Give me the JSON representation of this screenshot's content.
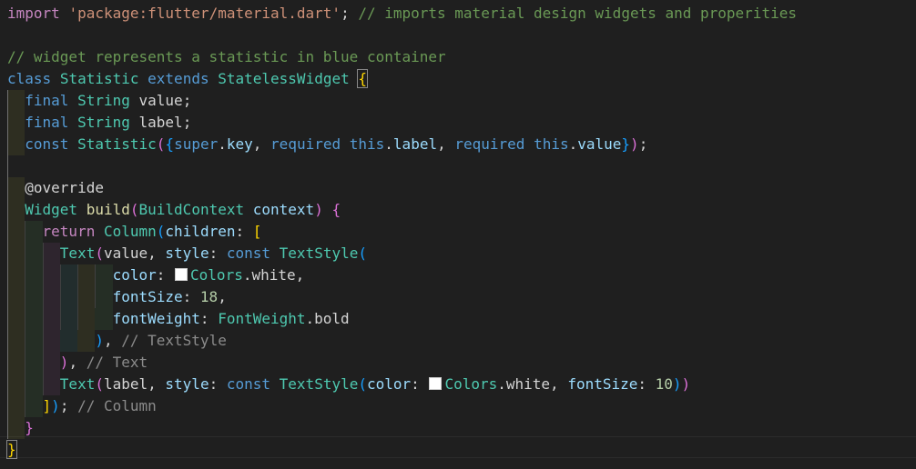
{
  "editor": {
    "language": "dart",
    "lines": [
      {
        "tokens": [
          {
            "t": "import",
            "c": "kw-pink"
          },
          {
            "t": " ",
            "c": "plain"
          },
          {
            "t": "'package:flutter/material.dart'",
            "c": "str"
          },
          {
            "t": "; ",
            "c": "plain"
          },
          {
            "t": "// imports material design widgets and properities",
            "c": "cmt"
          }
        ]
      },
      {
        "tokens": []
      },
      {
        "tokens": [
          {
            "t": "// widget represents a statistic in blue container",
            "c": "cmt"
          }
        ]
      },
      {
        "tokens": [
          {
            "t": "class",
            "c": "kw-blue"
          },
          {
            "t": " ",
            "c": "plain"
          },
          {
            "t": "Statistic",
            "c": "type"
          },
          {
            "t": " ",
            "c": "plain"
          },
          {
            "t": "extends",
            "c": "kw-blue"
          },
          {
            "t": " ",
            "c": "plain"
          },
          {
            "t": "StatelessWidget",
            "c": "type"
          },
          {
            "t": " ",
            "c": "plain"
          },
          {
            "t": "{",
            "c": "br-gold bracket-match"
          }
        ]
      },
      {
        "tokens": [
          {
            "t": "  ",
            "c": "plain"
          },
          {
            "t": "final",
            "c": "kw-blue"
          },
          {
            "t": " ",
            "c": "plain"
          },
          {
            "t": "String",
            "c": "type"
          },
          {
            "t": " ",
            "c": "plain"
          },
          {
            "t": "value",
            "c": "plain"
          },
          {
            "t": ";",
            "c": "plain"
          }
        ]
      },
      {
        "tokens": [
          {
            "t": "  ",
            "c": "plain"
          },
          {
            "t": "final",
            "c": "kw-blue"
          },
          {
            "t": " ",
            "c": "plain"
          },
          {
            "t": "String",
            "c": "type"
          },
          {
            "t": " ",
            "c": "plain"
          },
          {
            "t": "label",
            "c": "plain"
          },
          {
            "t": ";",
            "c": "plain"
          }
        ]
      },
      {
        "tokens": [
          {
            "t": "  ",
            "c": "plain"
          },
          {
            "t": "const",
            "c": "kw-blue"
          },
          {
            "t": " ",
            "c": "plain"
          },
          {
            "t": "Statistic",
            "c": "type"
          },
          {
            "t": "(",
            "c": "br-pink"
          },
          {
            "t": "{",
            "c": "br-blue"
          },
          {
            "t": "super",
            "c": "kw-blue"
          },
          {
            "t": ".",
            "c": "plain"
          },
          {
            "t": "key",
            "c": "var"
          },
          {
            "t": ", ",
            "c": "plain"
          },
          {
            "t": "required",
            "c": "kw-blue"
          },
          {
            "t": " ",
            "c": "plain"
          },
          {
            "t": "this",
            "c": "kw-blue"
          },
          {
            "t": ".",
            "c": "plain"
          },
          {
            "t": "label",
            "c": "var"
          },
          {
            "t": ", ",
            "c": "plain"
          },
          {
            "t": "required",
            "c": "kw-blue"
          },
          {
            "t": " ",
            "c": "plain"
          },
          {
            "t": "this",
            "c": "kw-blue"
          },
          {
            "t": ".",
            "c": "plain"
          },
          {
            "t": "value",
            "c": "var"
          },
          {
            "t": "}",
            "c": "br-blue"
          },
          {
            "t": ")",
            "c": "br-pink"
          },
          {
            "t": ";",
            "c": "plain"
          }
        ]
      },
      {
        "tokens": []
      },
      {
        "tokens": [
          {
            "t": "  ",
            "c": "plain"
          },
          {
            "t": "@override",
            "c": "plain"
          }
        ]
      },
      {
        "tokens": [
          {
            "t": "  ",
            "c": "plain"
          },
          {
            "t": "Widget",
            "c": "type"
          },
          {
            "t": " ",
            "c": "plain"
          },
          {
            "t": "build",
            "c": "fn"
          },
          {
            "t": "(",
            "c": "br-pink"
          },
          {
            "t": "BuildContext",
            "c": "type"
          },
          {
            "t": " ",
            "c": "plain"
          },
          {
            "t": "context",
            "c": "var"
          },
          {
            "t": ")",
            "c": "br-pink"
          },
          {
            "t": " ",
            "c": "plain"
          },
          {
            "t": "{",
            "c": "br-pink"
          }
        ]
      },
      {
        "tokens": [
          {
            "t": "    ",
            "c": "plain"
          },
          {
            "t": "return",
            "c": "kw-pink"
          },
          {
            "t": " ",
            "c": "plain"
          },
          {
            "t": "Column",
            "c": "type"
          },
          {
            "t": "(",
            "c": "br-blue"
          },
          {
            "t": "children",
            "c": "var"
          },
          {
            "t": ": ",
            "c": "plain"
          },
          {
            "t": "[",
            "c": "br-gold"
          }
        ]
      },
      {
        "tokens": [
          {
            "t": "      ",
            "c": "plain"
          },
          {
            "t": "Text",
            "c": "type"
          },
          {
            "t": "(",
            "c": "br-pink"
          },
          {
            "t": "value",
            "c": "plain"
          },
          {
            "t": ", ",
            "c": "plain"
          },
          {
            "t": "style",
            "c": "var"
          },
          {
            "t": ": ",
            "c": "plain"
          },
          {
            "t": "const",
            "c": "kw-blue"
          },
          {
            "t": " ",
            "c": "plain"
          },
          {
            "t": "TextStyle",
            "c": "type"
          },
          {
            "t": "(",
            "c": "br-blue"
          }
        ]
      },
      {
        "tokens": [
          {
            "t": "            ",
            "c": "plain"
          },
          {
            "t": "color",
            "c": "var"
          },
          {
            "t": ": ",
            "c": "plain"
          },
          {
            "t": "",
            "c": "swatch"
          },
          {
            "t": "Colors",
            "c": "type"
          },
          {
            "t": ".",
            "c": "plain"
          },
          {
            "t": "white",
            "c": "plain"
          },
          {
            "t": ",",
            "c": "plain"
          }
        ]
      },
      {
        "tokens": [
          {
            "t": "            ",
            "c": "plain"
          },
          {
            "t": "fontSize",
            "c": "var"
          },
          {
            "t": ": ",
            "c": "plain"
          },
          {
            "t": "18",
            "c": "num"
          },
          {
            "t": ",",
            "c": "plain"
          }
        ]
      },
      {
        "tokens": [
          {
            "t": "            ",
            "c": "plain"
          },
          {
            "t": "fontWeight",
            "c": "var"
          },
          {
            "t": ": ",
            "c": "plain"
          },
          {
            "t": "FontWeight",
            "c": "type"
          },
          {
            "t": ".",
            "c": "plain"
          },
          {
            "t": "bold",
            "c": "plain"
          }
        ]
      },
      {
        "tokens": [
          {
            "t": "          ",
            "c": "plain"
          },
          {
            "t": ")",
            "c": "br-blue"
          },
          {
            "t": ", ",
            "c": "plain"
          },
          {
            "t": "// TextStyle",
            "c": "cmt-gray"
          }
        ]
      },
      {
        "tokens": [
          {
            "t": "      ",
            "c": "plain"
          },
          {
            "t": ")",
            "c": "br-pink"
          },
          {
            "t": ", ",
            "c": "plain"
          },
          {
            "t": "// Text",
            "c": "cmt-gray"
          }
        ]
      },
      {
        "tokens": [
          {
            "t": "      ",
            "c": "plain"
          },
          {
            "t": "Text",
            "c": "type"
          },
          {
            "t": "(",
            "c": "br-pink"
          },
          {
            "t": "label",
            "c": "plain"
          },
          {
            "t": ", ",
            "c": "plain"
          },
          {
            "t": "style",
            "c": "var"
          },
          {
            "t": ": ",
            "c": "plain"
          },
          {
            "t": "const",
            "c": "kw-blue"
          },
          {
            "t": " ",
            "c": "plain"
          },
          {
            "t": "TextStyle",
            "c": "type"
          },
          {
            "t": "(",
            "c": "br-blue"
          },
          {
            "t": "color",
            "c": "var"
          },
          {
            "t": ": ",
            "c": "plain"
          },
          {
            "t": "",
            "c": "swatch"
          },
          {
            "t": "Colors",
            "c": "type"
          },
          {
            "t": ".",
            "c": "plain"
          },
          {
            "t": "white",
            "c": "plain"
          },
          {
            "t": ", ",
            "c": "plain"
          },
          {
            "t": "fontSize",
            "c": "var"
          },
          {
            "t": ": ",
            "c": "plain"
          },
          {
            "t": "10",
            "c": "num"
          },
          {
            "t": ")",
            "c": "br-blue"
          },
          {
            "t": ")",
            "c": "br-pink"
          }
        ]
      },
      {
        "tokens": [
          {
            "t": "    ",
            "c": "plain"
          },
          {
            "t": "]",
            "c": "br-gold"
          },
          {
            "t": ")",
            "c": "br-blue"
          },
          {
            "t": "; ",
            "c": "plain"
          },
          {
            "t": "// Column",
            "c": "cmt-gray"
          }
        ]
      },
      {
        "tokens": [
          {
            "t": "  ",
            "c": "plain"
          },
          {
            "t": "}",
            "c": "br-pink"
          }
        ]
      },
      {
        "tokens": [
          {
            "t": "}",
            "c": "br-gold bracket-match"
          }
        ]
      }
    ]
  }
}
